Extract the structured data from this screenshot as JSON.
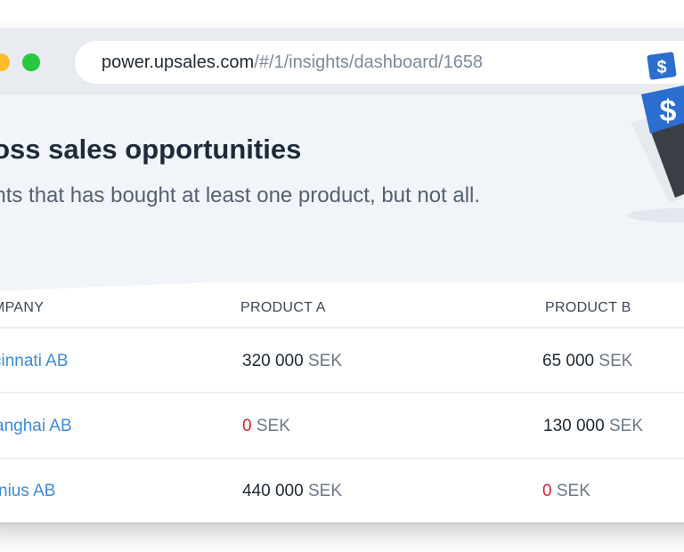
{
  "browser": {
    "url_domain": "power.upsales.com",
    "url_path": "/#/1/insights/dashboard/1658"
  },
  "header": {
    "title": "ross sales opportunities",
    "subtitle": "ents that has bought at least one product, but not all."
  },
  "illustration": {
    "icon": "dollar-sign-icon",
    "symbol_small": "$",
    "symbol_large": "$"
  },
  "table": {
    "columns": [
      "MPANY",
      "PRODUCT A",
      "PRODUCT B"
    ],
    "rows": [
      {
        "company": "cinnati AB",
        "product_a": {
          "value": "320 000",
          "unit": "SEK"
        },
        "product_b": {
          "value": "65 000",
          "unit": "SEK"
        }
      },
      {
        "company": "anghai AB",
        "product_a": {
          "value": "0",
          "unit": "SEK"
        },
        "product_b": {
          "value": "130 000",
          "unit": "SEK"
        }
      },
      {
        "company": "nius AB",
        "product_a": {
          "value": "440 000",
          "unit": "SEK"
        },
        "product_b": {
          "value": "0",
          "unit": "SEK"
        }
      }
    ]
  },
  "colors": {
    "link": "#3d8bd9",
    "zero_value": "#d8232a",
    "accent_blue": "#2c6dd0",
    "hero_background": "#f1f5fa"
  }
}
